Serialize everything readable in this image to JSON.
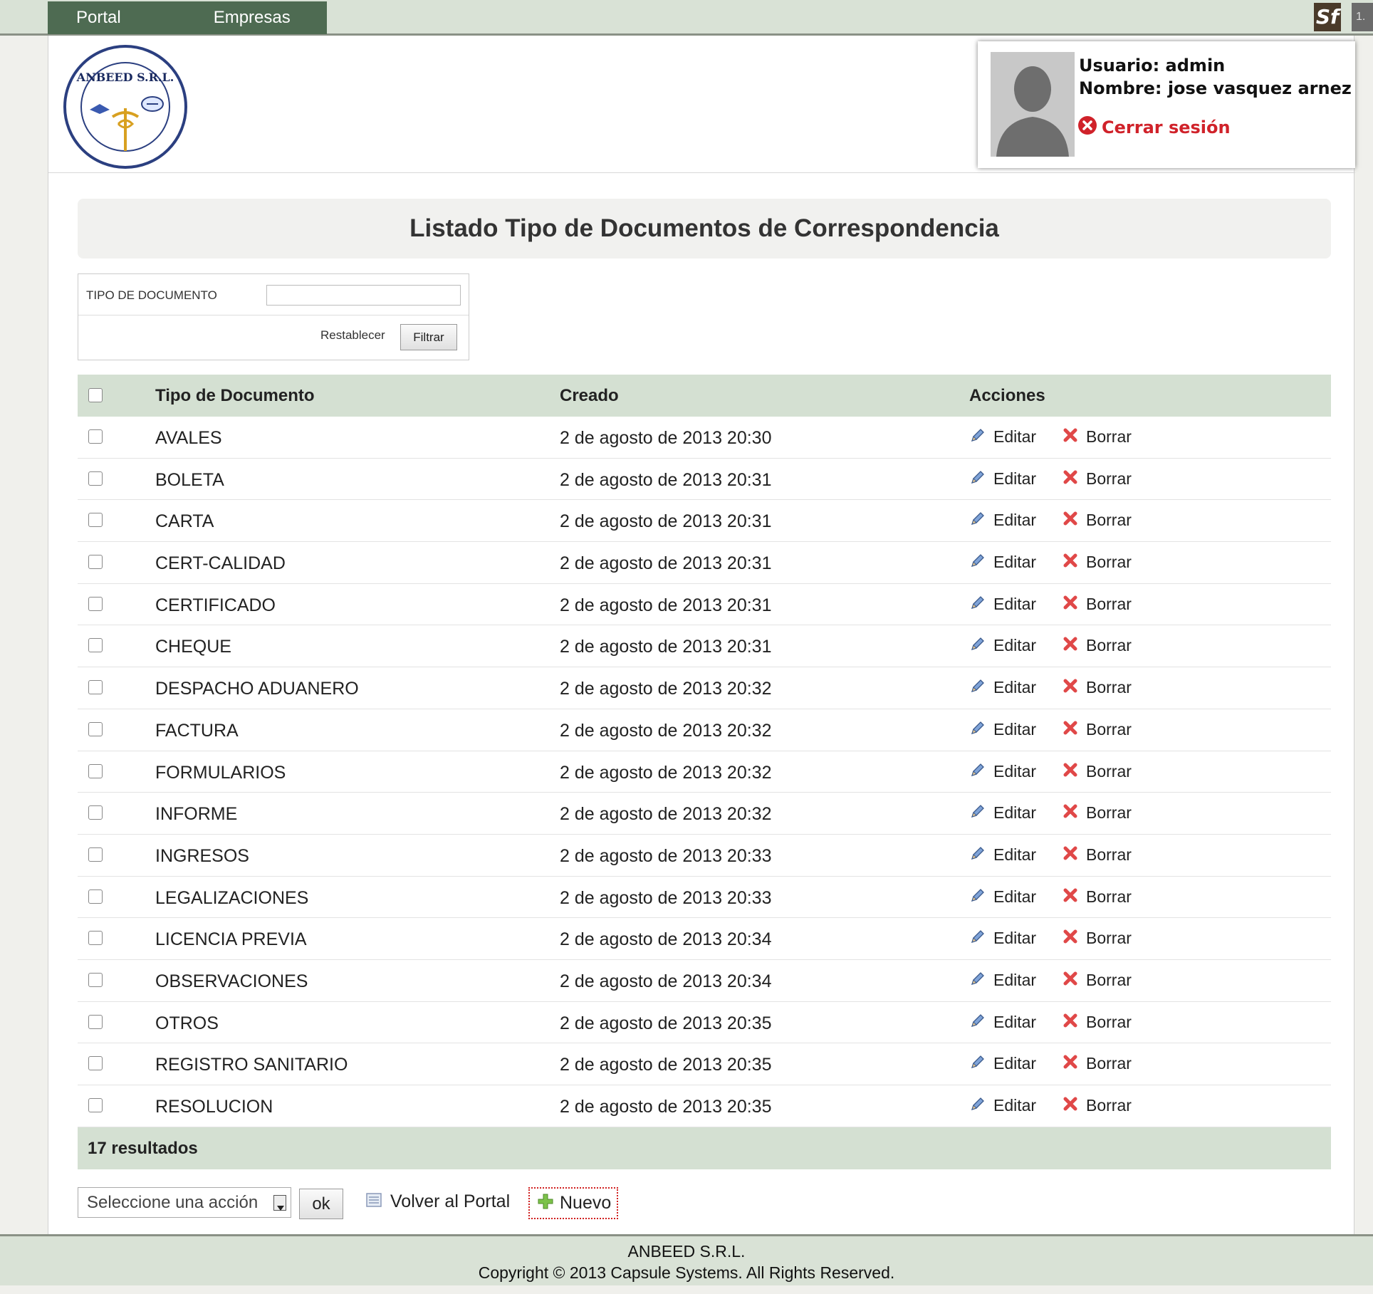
{
  "nav": {
    "portal": "Portal",
    "empresas": "Empresas"
  },
  "toolbar": {
    "sf_logo": "Sf",
    "version": "1."
  },
  "user": {
    "usuario": "Usuario: admin",
    "nombre": "Nombre: jose vasquez arnez",
    "logout": "Cerrar sesión"
  },
  "logo": {
    "text": "ANBEED S.R.L."
  },
  "page": {
    "title": "Listado Tipo de Documentos de Correspondencia"
  },
  "filter": {
    "label": "TIPO DE DOCUMENTO",
    "value": "",
    "reset": "Restablecer",
    "submit": "Filtrar"
  },
  "table": {
    "headers": {
      "tipo": "Tipo de Documento",
      "creado": "Creado",
      "acciones": "Acciones"
    },
    "edit_label": "Editar",
    "delete_label": "Borrar",
    "rows": [
      {
        "tipo": "AVALES",
        "creado": "2 de agosto de 2013 20:30"
      },
      {
        "tipo": "BOLETA",
        "creado": "2 de agosto de 2013 20:31"
      },
      {
        "tipo": "CARTA",
        "creado": "2 de agosto de 2013 20:31"
      },
      {
        "tipo": "CERT-CALIDAD",
        "creado": "2 de agosto de 2013 20:31"
      },
      {
        "tipo": "CERTIFICADO",
        "creado": "2 de agosto de 2013 20:31"
      },
      {
        "tipo": "CHEQUE",
        "creado": "2 de agosto de 2013 20:31"
      },
      {
        "tipo": "DESPACHO ADUANERO",
        "creado": "2 de agosto de 2013 20:32"
      },
      {
        "tipo": "FACTURA",
        "creado": "2 de agosto de 2013 20:32"
      },
      {
        "tipo": "FORMULARIOS",
        "creado": "2 de agosto de 2013 20:32"
      },
      {
        "tipo": "INFORME",
        "creado": "2 de agosto de 2013 20:32"
      },
      {
        "tipo": "INGRESOS",
        "creado": "2 de agosto de 2013 20:33"
      },
      {
        "tipo": "LEGALIZACIONES",
        "creado": "2 de agosto de 2013 20:33"
      },
      {
        "tipo": "LICENCIA PREVIA",
        "creado": "2 de agosto de 2013 20:34"
      },
      {
        "tipo": "OBSERVACIONES",
        "creado": "2 de agosto de 2013 20:34"
      },
      {
        "tipo": "OTROS",
        "creado": "2 de agosto de 2013 20:35"
      },
      {
        "tipo": "REGISTRO SANITARIO",
        "creado": "2 de agosto de 2013 20:35"
      },
      {
        "tipo": "RESOLUCION",
        "creado": "2 de agosto de 2013 20:35"
      }
    ],
    "footer": "17 resultados"
  },
  "actions": {
    "select_placeholder": "Seleccione una acción",
    "ok": "ok",
    "back": "Volver al Portal",
    "new": "Nuevo"
  },
  "footer": {
    "company": "ANBEED S.R.L.",
    "copyright": "Copyright © 2013 Capsule Systems. All Rights Reserved."
  },
  "icons": {
    "edit": "pencil-icon",
    "delete": "red-x-icon",
    "logout": "red-circle-x-icon",
    "new": "green-plus-icon",
    "back": "list-icon"
  },
  "colors": {
    "nav_bg": "#4e6b52",
    "bar_bg": "#d9e2d6",
    "table_header_bg": "#d4e0d2",
    "logout": "#d0222a"
  }
}
